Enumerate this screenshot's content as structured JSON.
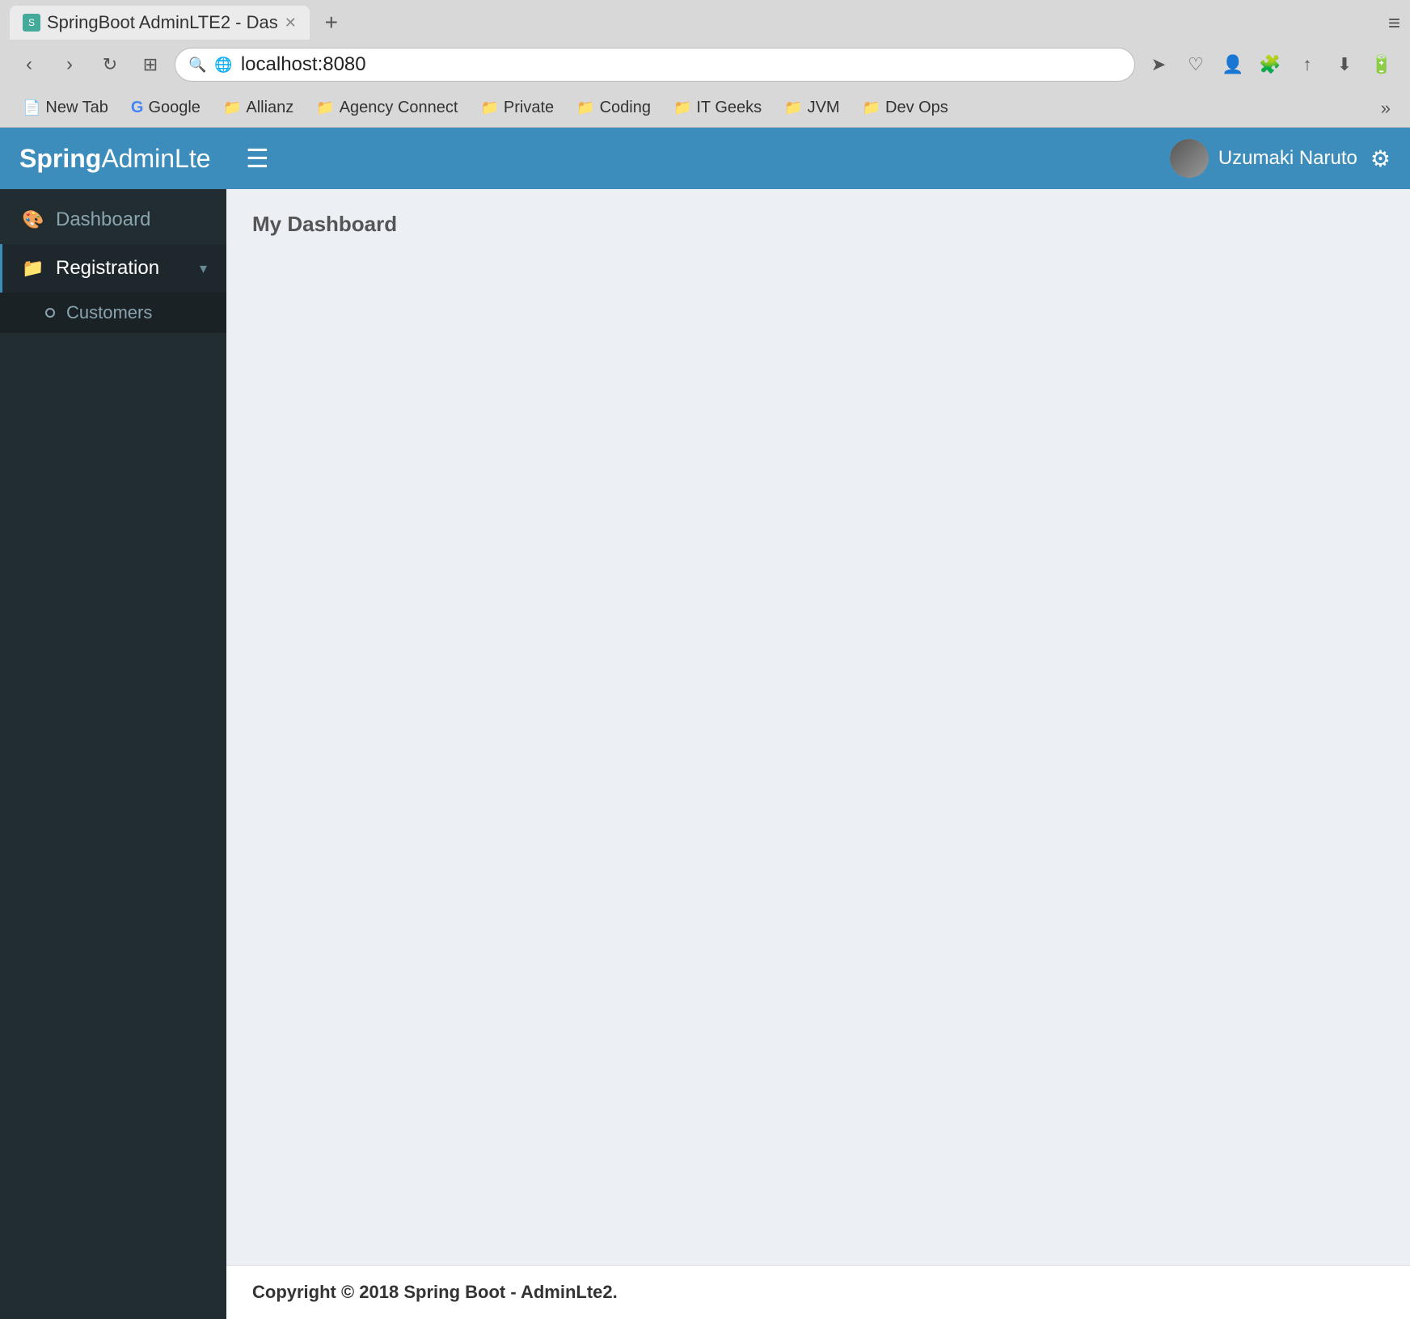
{
  "browser": {
    "tab": {
      "title": "SpringBoot AdminLTE2 - Das",
      "favicon_text": "S"
    },
    "new_tab_label": "+",
    "menu_label": "≡",
    "address": "localhost:8080",
    "back_btn": "‹",
    "forward_btn": "›",
    "reload_btn": "↻",
    "grid_btn": "⊞",
    "bookmarks": [
      {
        "label": "New Tab",
        "icon": "📄"
      },
      {
        "label": "Google",
        "icon": "G"
      },
      {
        "label": "Allianz",
        "icon": "📁"
      },
      {
        "label": "Agency Connect",
        "icon": "📁"
      },
      {
        "label": "Private",
        "icon": "📁"
      },
      {
        "label": "Coding",
        "icon": "📁"
      },
      {
        "label": "IT Geeks",
        "icon": "📁"
      },
      {
        "label": "JVM",
        "icon": "📁"
      },
      {
        "label": "Dev Ops",
        "icon": "📁"
      }
    ],
    "more_bookmarks": "»"
  },
  "app": {
    "logo": {
      "spring": "Spring",
      "admin": "Admin",
      "lte": "Lte"
    },
    "header": {
      "hamburger": "☰",
      "username": "Uzumaki Naruto",
      "settings_icon": "⚙"
    },
    "sidebar": {
      "items": [
        {
          "id": "dashboard",
          "label": "Dashboard",
          "icon": "🎨",
          "active": false
        },
        {
          "id": "registration",
          "label": "Registration",
          "icon": "📁",
          "active": true,
          "has_arrow": true
        }
      ],
      "submenu": [
        {
          "id": "customers",
          "label": "Customers"
        }
      ]
    },
    "main": {
      "page_title": "My Dashboard",
      "footer_text": "Copyright © 2018 Spring Boot - AdminLte2."
    }
  }
}
